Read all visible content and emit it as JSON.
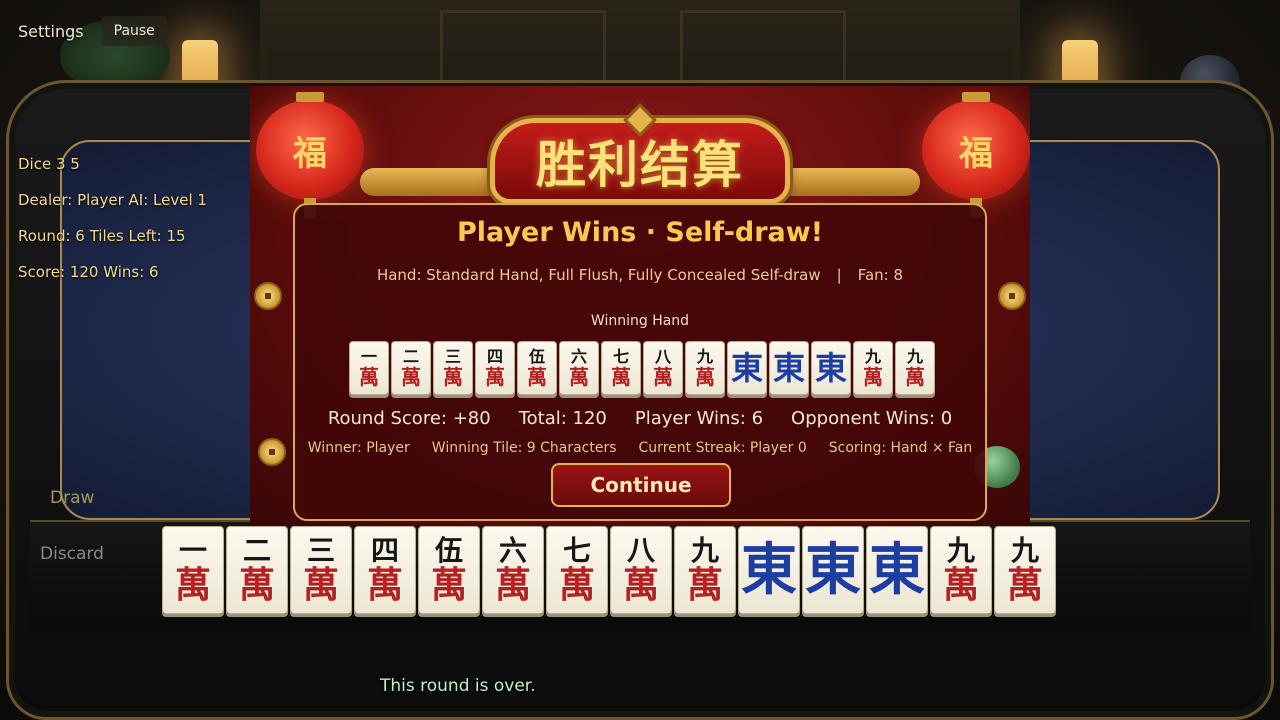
{
  "hud": {
    "settings_label": "Settings",
    "pause_label": "Pause",
    "dice": "Dice 3 5",
    "dealer": "Dealer: Player  AI: Level 1",
    "round": "Round: 6  Tiles Left: 15",
    "score": "Score: 120  Wins: 6",
    "draw_label": "Draw",
    "discard_label": "Discard",
    "status_message": "This round is over."
  },
  "decor": {
    "lantern_char": "福"
  },
  "result": {
    "banner_title": "胜利结算",
    "headline": "Player Wins · Self-draw!",
    "hand_text": "Hand: Standard Hand, Full Flush, Fully Concealed Self-draw",
    "separator": "|",
    "fan_text": "Fan: 8",
    "winning_hand_label": "Winning Hand",
    "round_score": "Round Score: +80",
    "total": "Total: 120",
    "player_wins": "Player Wins: 6",
    "opponent_wins": "Opponent Wins: 0",
    "winner": "Winner: Player",
    "winning_tile": "Winning Tile: 9 Characters",
    "streak": "Current Streak: Player 0",
    "scoring": "Scoring: Hand × Fan",
    "continue_label": "Continue"
  },
  "colors": {
    "character_red": "#b32121",
    "wind_blue": "#1c3ea3",
    "gold": "#e6b24a"
  },
  "tiles": [
    {
      "top": "一",
      "bottom": "萬",
      "kind": "character"
    },
    {
      "top": "二",
      "bottom": "萬",
      "kind": "character"
    },
    {
      "top": "三",
      "bottom": "萬",
      "kind": "character"
    },
    {
      "top": "四",
      "bottom": "萬",
      "kind": "character"
    },
    {
      "top": "伍",
      "bottom": "萬",
      "kind": "character"
    },
    {
      "top": "六",
      "bottom": "萬",
      "kind": "character"
    },
    {
      "top": "七",
      "bottom": "萬",
      "kind": "character"
    },
    {
      "top": "八",
      "bottom": "萬",
      "kind": "character"
    },
    {
      "top": "九",
      "bottom": "萬",
      "kind": "character"
    },
    {
      "glyph": "東",
      "kind": "wind"
    },
    {
      "glyph": "東",
      "kind": "wind"
    },
    {
      "glyph": "東",
      "kind": "wind"
    },
    {
      "top": "九",
      "bottom": "萬",
      "kind": "character"
    },
    {
      "top": "九",
      "bottom": "萬",
      "kind": "character"
    }
  ]
}
